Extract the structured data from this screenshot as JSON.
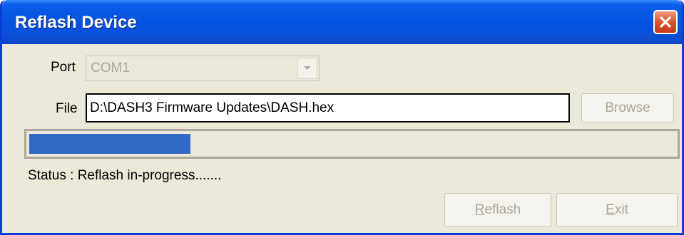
{
  "window": {
    "title": "Reflash Device"
  },
  "port": {
    "label": "Port",
    "value": "COM1",
    "enabled": false
  },
  "file": {
    "label": "File",
    "value": "D:\\DASH3 Firmware Updates\\DASH.hex"
  },
  "buttons": {
    "browse": "Browse",
    "reflash_mnemonic": "R",
    "reflash_rest": "eflash",
    "exit_mnemonic": "E",
    "exit_rest": "xit"
  },
  "progress": {
    "fraction": 0.25
  },
  "status": {
    "text": "Status : Reflash in-progress......."
  },
  "colors": {
    "titlebar": "#0553e2",
    "progress_fill": "#3169c6",
    "close_button": "#e0522d",
    "disabled_text": "#aca899",
    "dialog_bg": "#ece9d8"
  },
  "icons": {
    "close": "close-icon",
    "dropdown": "chevron-down-icon"
  }
}
